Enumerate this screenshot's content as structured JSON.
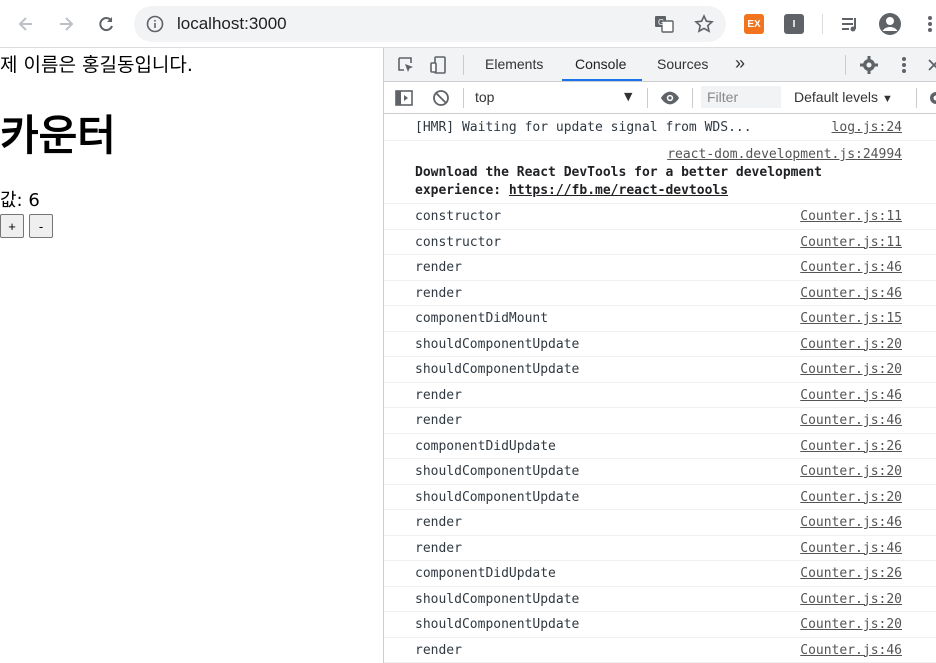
{
  "browser": {
    "url": "localhost:3000",
    "extensions": [
      {
        "label": "EX",
        "color": "#f2741e"
      },
      {
        "label": "I",
        "color": "#5f6368"
      }
    ]
  },
  "page": {
    "greeting": "제 이름은 홍길동입니다.",
    "heading": "카운터",
    "value_text": "값: 6",
    "plus_label": "+",
    "minus_label": "-"
  },
  "devtools": {
    "tabs": [
      "Elements",
      "Console",
      "Sources"
    ],
    "active_tab": "Console",
    "more_tabs": "»",
    "context": "top",
    "filter_placeholder": "Filter",
    "levels": "Default levels",
    "accent": "#1a73e8",
    "hmr": {
      "message": "[HMR] Waiting for update signal from WDS...",
      "source": "log.js:24"
    },
    "react_notice": {
      "source": "react-dom.development.js:24994",
      "line1": "Download the React DevTools for a better development",
      "line2_prefix": "experience: ",
      "link": "https://fb.me/react-devtools"
    },
    "logs": [
      {
        "message": "constructor",
        "source": "Counter.js:11"
      },
      {
        "message": "constructor",
        "source": "Counter.js:11"
      },
      {
        "message": "render",
        "source": "Counter.js:46"
      },
      {
        "message": "render",
        "source": "Counter.js:46"
      },
      {
        "message": "componentDidMount",
        "source": "Counter.js:15"
      },
      {
        "message": "shouldComponentUpdate",
        "source": "Counter.js:20"
      },
      {
        "message": "shouldComponentUpdate",
        "source": "Counter.js:20"
      },
      {
        "message": "render",
        "source": "Counter.js:46"
      },
      {
        "message": "render",
        "source": "Counter.js:46"
      },
      {
        "message": "componentDidUpdate",
        "source": "Counter.js:26"
      },
      {
        "message": "shouldComponentUpdate",
        "source": "Counter.js:20"
      },
      {
        "message": "shouldComponentUpdate",
        "source": "Counter.js:20"
      },
      {
        "message": "render",
        "source": "Counter.js:46"
      },
      {
        "message": "render",
        "source": "Counter.js:46"
      },
      {
        "message": "componentDidUpdate",
        "source": "Counter.js:26"
      },
      {
        "message": "shouldComponentUpdate",
        "source": "Counter.js:20"
      },
      {
        "message": "shouldComponentUpdate",
        "source": "Counter.js:20"
      },
      {
        "message": "render",
        "source": "Counter.js:46"
      }
    ]
  }
}
